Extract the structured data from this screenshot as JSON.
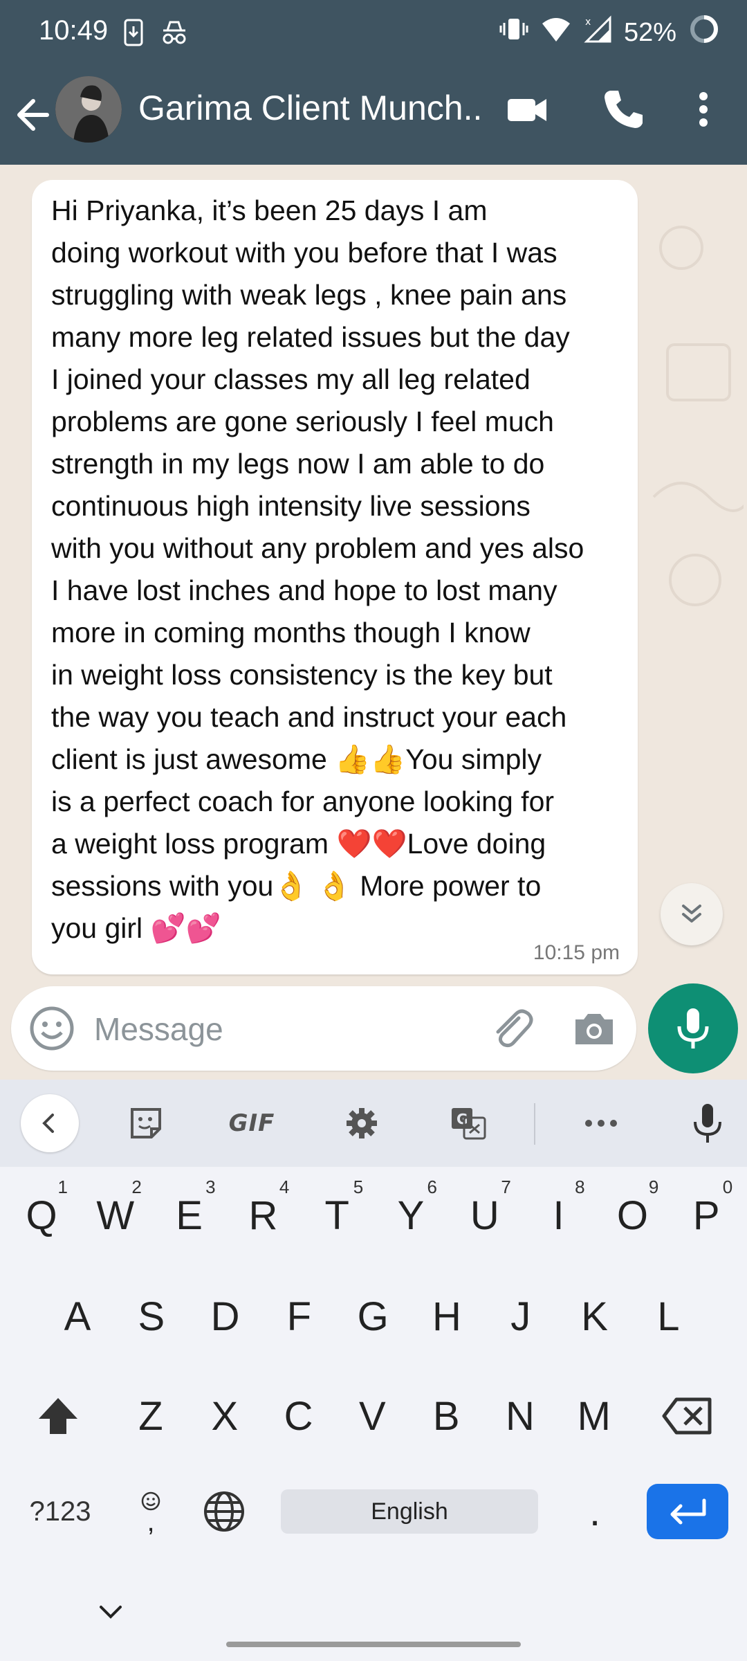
{
  "status_bar": {
    "time": "10:49",
    "battery_percent": "52%"
  },
  "header": {
    "contact_name": "Garima Client Munch...",
    "icons": [
      "back-arrow-icon",
      "avatar",
      "video-call-icon",
      "voice-call-icon",
      "more-vert-icon"
    ]
  },
  "message": {
    "lines": [
      "Hi Priyanka, it’s been  25 days I am",
      "doing workout with you before that I was",
      "struggling with weak legs , knee pain ans",
      "many more leg related issues but the day",
      "I joined your classes my all leg related",
      "problems are gone seriously I feel much",
      "strength in my legs now I am able to do",
      "continuous high intensity live sessions",
      "with you without any problem and yes also",
      "I  have lost inches and hope to lost many",
      "more in coming months though I know",
      "in weight loss consistency is the key but",
      "the way you teach and instruct your each",
      "client is just awesome 👍👍You simply",
      "is a perfect coach for anyone looking for",
      "a weight loss program ❤️❤️Love  doing",
      "sessions with you👌 👌 More power to",
      "you girl 💕💕"
    ],
    "time": "10:15 pm"
  },
  "composer": {
    "placeholder": "Message"
  },
  "keyboard": {
    "toolbar": {
      "gif_label": "GIF"
    },
    "row1": [
      {
        "k": "Q",
        "h": "1"
      },
      {
        "k": "W",
        "h": "2"
      },
      {
        "k": "E",
        "h": "3"
      },
      {
        "k": "R",
        "h": "4"
      },
      {
        "k": "T",
        "h": "5"
      },
      {
        "k": "Y",
        "h": "6"
      },
      {
        "k": "U",
        "h": "7"
      },
      {
        "k": "I",
        "h": "8"
      },
      {
        "k": "O",
        "h": "9"
      },
      {
        "k": "P",
        "h": "0"
      }
    ],
    "row2": [
      "A",
      "S",
      "D",
      "F",
      "G",
      "H",
      "J",
      "K",
      "L"
    ],
    "row3": [
      "Z",
      "X",
      "C",
      "V",
      "B",
      "N",
      "M"
    ],
    "symbols_label": "?123",
    "comma_label": ",",
    "space_label": "English",
    "period_label": "."
  },
  "colors": {
    "header_bg": "#3f5461",
    "chat_bg": "#efe7de",
    "accent_green": "#0e8f74",
    "enter_blue": "#1a73e8"
  }
}
